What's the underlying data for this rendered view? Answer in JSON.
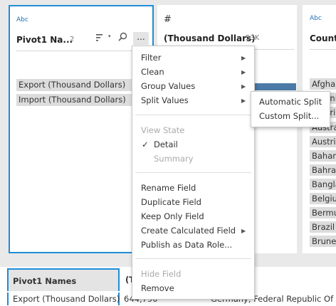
{
  "cards": {
    "pivot": {
      "type_label": "Abc",
      "name": "Pivot1 Na...",
      "count": "2",
      "values": [
        "Export (Thousand Dollars)",
        "Import (Thousand Dollars)"
      ],
      "more_label": "..."
    },
    "thousand": {
      "type_label": "#",
      "name": "(Thousand Dollars)",
      "count": "53K"
    },
    "country": {
      "type_label": "Abc",
      "name": "Countr",
      "values": [
        "Afghan",
        "Albanii",
        "Algeria",
        "Austra",
        "Austria",
        "Bahan",
        "Bahra",
        "Bangla",
        "Belgiu",
        "Bermu",
        "Brazil",
        "Brune"
      ]
    }
  },
  "menu": {
    "filter": "Filter",
    "clean": "Clean",
    "group_values": "Group Values",
    "split_values": "Split Values",
    "view_state": "View State",
    "detail_check": "✓",
    "detail": "Detail",
    "summary": "Summary",
    "rename_field": "Rename Field",
    "duplicate_field": "Duplicate Field",
    "keep_only_field": "Keep Only Field",
    "create_calculated_field": "Create Calculated Field",
    "publish_as_data_role": "Publish as Data Role...",
    "hide_field": "Hide Field",
    "remove": "Remove"
  },
  "submenu": {
    "automatic_split": "Automatic Split",
    "custom_split": "Custom Split..."
  },
  "grid": {
    "headers": [
      "Pivot1 Names",
      "(T"
    ],
    "row": [
      "Export (Thousand Dollars)",
      "644,790",
      "Germany, Federal Republic Of"
    ]
  },
  "colors": {
    "accent": "#1f8dd6",
    "bar": "#4b7aa6"
  }
}
